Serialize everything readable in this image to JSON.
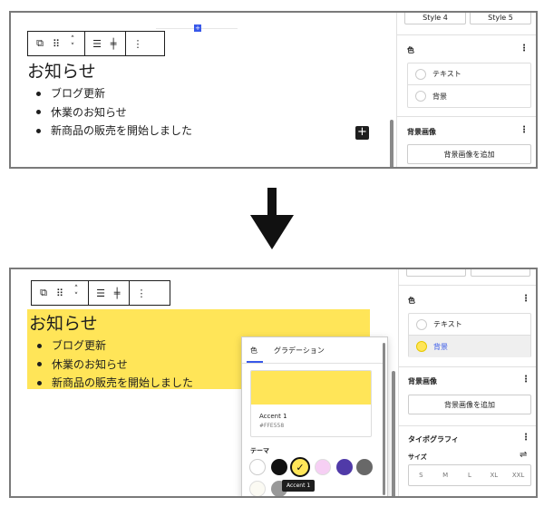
{
  "before": {
    "heading": "お知らせ",
    "list_items": [
      "ブログ更新",
      "休業のお知らせ",
      "新商品の販売を開始しました"
    ],
    "sidebar": {
      "styles": [
        "Style 4",
        "Style 5"
      ],
      "color_section": "色",
      "color_rows": [
        "テキスト",
        "背景"
      ],
      "bgimage_section": "背景画像",
      "bgimage_button": "背景画像を追加"
    }
  },
  "after": {
    "heading": "お知らせ",
    "list_items": [
      "ブログ更新",
      "休業のお知らせ",
      "新商品の販売を開始しました"
    ],
    "highlight_color": "#FFE558",
    "sidebar": {
      "color_section": "色",
      "color_rows": [
        "テキスト",
        "背景"
      ],
      "bgimage_section": "背景画像",
      "bgimage_button": "背景画像を追加",
      "typography_section": "タイポグラフィ",
      "size_label": "サイズ",
      "sizes": [
        "S",
        "M",
        "L",
        "XL",
        "XXL"
      ]
    },
    "popover": {
      "tabs": [
        "色",
        "グラデーション"
      ],
      "selected_name": "Accent 1",
      "selected_hex": "#FFE558",
      "palette_label": "テーマ",
      "tooltip": "Accent 1",
      "palette": [
        {
          "name": "white",
          "color": "#FFFFFF"
        },
        {
          "name": "black",
          "color": "#111111"
        },
        {
          "name": "Accent 1",
          "color": "#FFE558"
        },
        {
          "name": "pink",
          "color": "#F6CFF4"
        },
        {
          "name": "indigo",
          "color": "#503AA8"
        },
        {
          "name": "gray",
          "color": "#686868"
        },
        {
          "name": "cream",
          "color": "#FBFAF3"
        },
        {
          "name": "light-gray",
          "color": "#999999"
        }
      ]
    }
  },
  "icons": [
    "transform-icon",
    "drag-icon",
    "move-arrows-icon",
    "align-icon",
    "justify-icon",
    "more-options-icon",
    "add-block-icon",
    "down-arrow-icon",
    "checkmark-icon",
    "settings-icon"
  ]
}
